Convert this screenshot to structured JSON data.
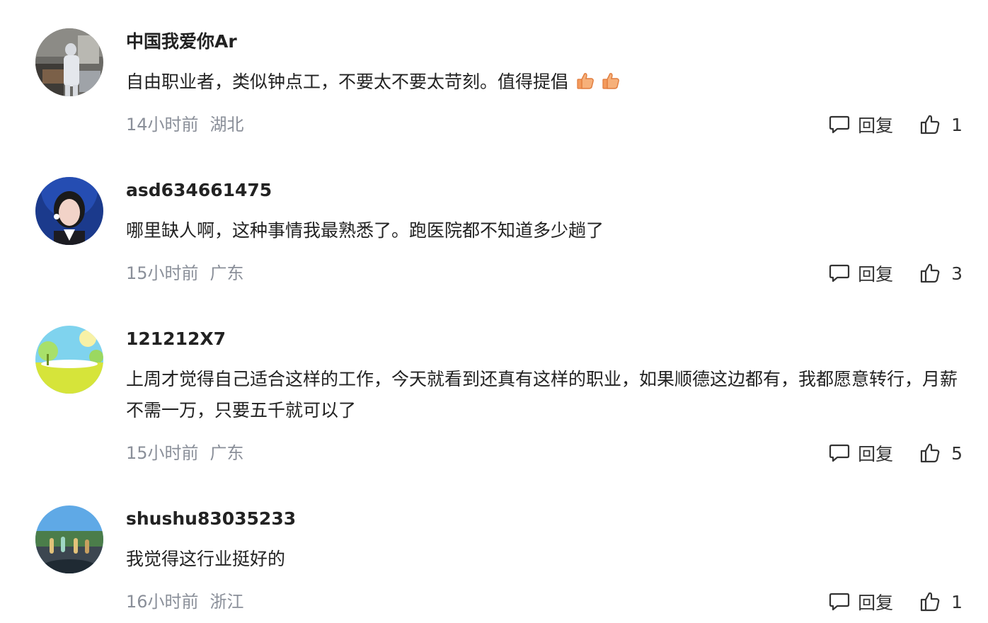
{
  "comments": [
    {
      "username": "中国我爱你Ar",
      "text": "自由职业者，类似钟点工，不要太不要太苛刻。值得提倡",
      "emojis": [
        "thumbs-up-emoji",
        "thumbs-up-emoji"
      ],
      "time": "14小时前",
      "location": "湖北",
      "reply_label": "回复",
      "likes": "1",
      "avatar": "photo-avatar-room"
    },
    {
      "username": "asd634661475",
      "text": "哪里缺人啊，这种事情我最熟悉了。跑医院都不知道多少趟了",
      "time": "15小时前",
      "location": "广东",
      "reply_label": "回复",
      "likes": "3",
      "avatar": "photo-avatar-woman"
    },
    {
      "username": "121212X7",
      "text": "上周才觉得自己适合这样的工作，今天就看到还真有这样的职业，如果顺德这边都有，我都愿意转行，月薪不需一万，只要五千就可以了",
      "time": "15小时前",
      "location": "广东",
      "reply_label": "回复",
      "likes": "5",
      "avatar": "cartoon-avatar-landscape"
    },
    {
      "username": "shushu83035233",
      "text": "我觉得这行业挺好的",
      "time": "16小时前",
      "location": "浙江",
      "reply_label": "回复",
      "likes": "1",
      "avatar": "photo-avatar-beach"
    }
  ]
}
